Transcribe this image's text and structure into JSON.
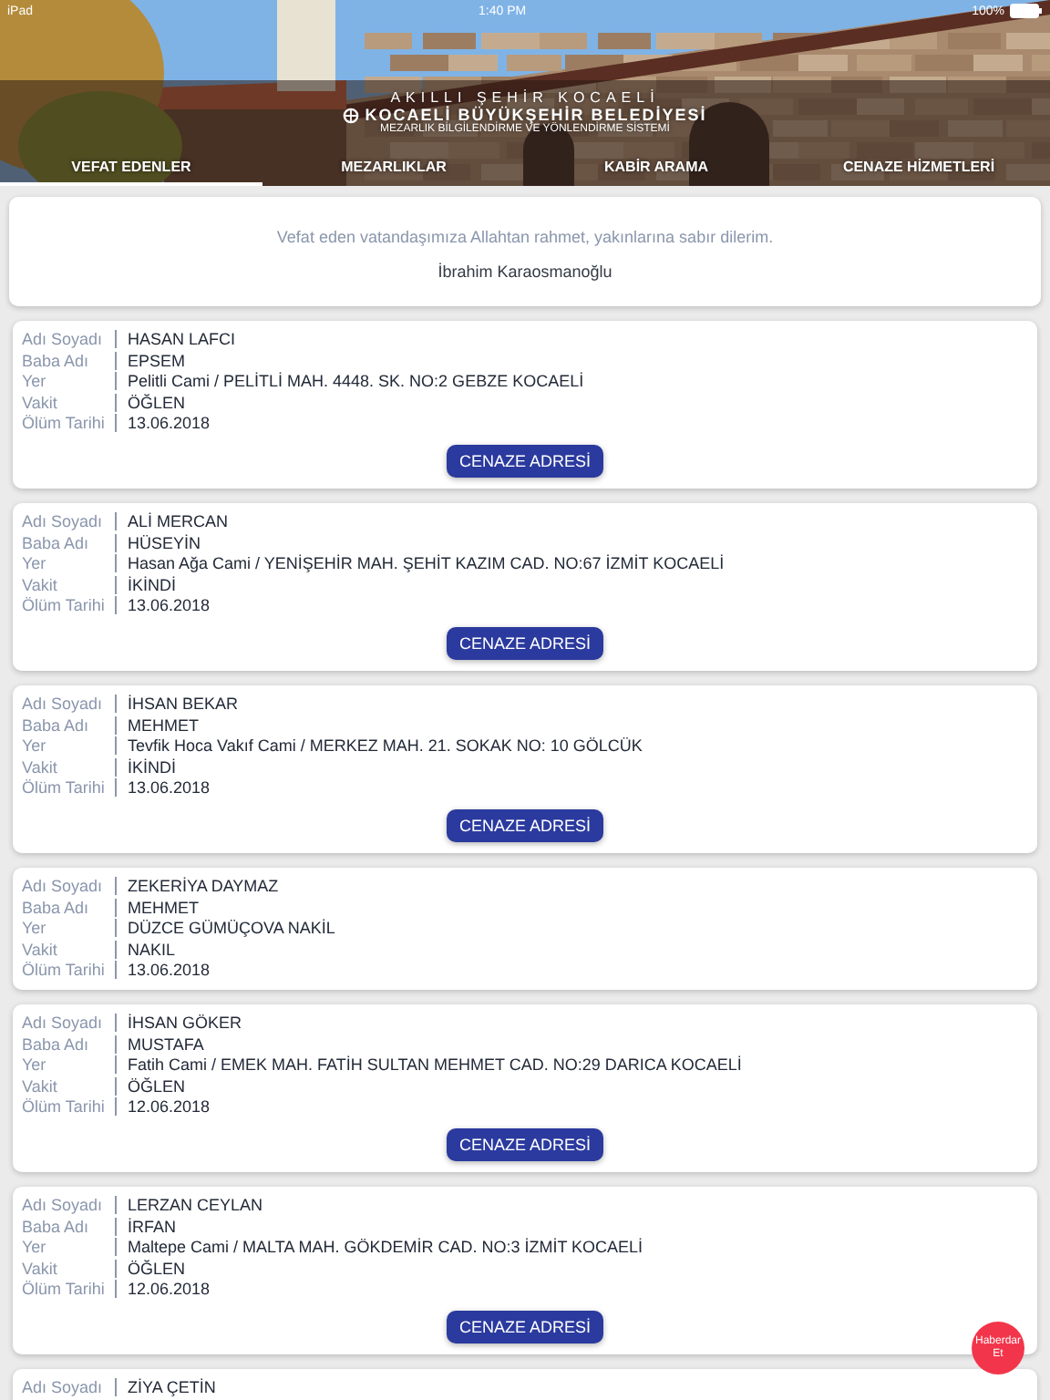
{
  "status_bar": {
    "carrier": "iPad",
    "time": "1:40 PM",
    "battery": "100%"
  },
  "header": {
    "tagline": "AKILLI ŞEHİR KOCAELİ",
    "title": "KOCAELİ BÜYÜKŞEHİR BELEDİYESİ",
    "subtitle": "MEZARLIK BİLGİLENDİRME VE YÖNLENDİRME SİSTEMİ"
  },
  "tabs": [
    {
      "label": "VEFAT EDENLER",
      "selected": true
    },
    {
      "label": "MEZARLIKLAR",
      "selected": false
    },
    {
      "label": "KABİR ARAMA",
      "selected": false
    },
    {
      "label": "CENAZE HİZMETLERİ",
      "selected": false
    }
  ],
  "intro": {
    "message": "Vefat eden vatandaşımıza Allahtan rahmet, yakınlarına sabır dilerim.",
    "signature": "İbrahim Karaosmanoğlu"
  },
  "records": [
    {
      "fields": [
        {
          "label": "Adı Soyadı",
          "value": "HASAN LAFCI"
        },
        {
          "label": "Baba Adı",
          "value": "EPSEM"
        },
        {
          "label": "Yer",
          "value": "Pelitli Cami / PELİTLİ MAH. 4448. SK. NO:2 GEBZE KOCAELİ"
        },
        {
          "label": "Vakit",
          "value": "ÖĞLEN"
        },
        {
          "label": "Ölüm Tarihi",
          "value": "13.06.2018"
        }
      ],
      "button": "CENAZE ADRESİ"
    },
    {
      "fields": [
        {
          "label": "Adı Soyadı",
          "value": "ALİ MERCAN"
        },
        {
          "label": "Baba Adı",
          "value": "HÜSEYİN"
        },
        {
          "label": "Yer",
          "value": "Hasan Ağa Cami / YENİŞEHİR MAH. ŞEHİT KAZIM CAD. NO:67 İZMİT KOCAELİ"
        },
        {
          "label": "Vakit",
          "value": "İKİNDİ"
        },
        {
          "label": "Ölüm Tarihi",
          "value": "13.06.2018"
        }
      ],
      "button": "CENAZE ADRESİ"
    },
    {
      "fields": [
        {
          "label": "Adı Soyadı",
          "value": "İHSAN BEKAR"
        },
        {
          "label": "Baba Adı",
          "value": "MEHMET"
        },
        {
          "label": "Yer",
          "value": "Tevfik Hoca Vakıf Cami / MERKEZ MAH. 21. SOKAK NO: 10 GÖLCÜK"
        },
        {
          "label": "Vakit",
          "value": "İKİNDİ"
        },
        {
          "label": "Ölüm Tarihi",
          "value": "13.06.2018"
        }
      ],
      "button": "CENAZE ADRESİ"
    },
    {
      "fields": [
        {
          "label": "Adı Soyadı",
          "value": "ZEKERİYA DAYMAZ"
        },
        {
          "label": "Baba Adı",
          "value": "MEHMET"
        },
        {
          "label": "Yer",
          "value": "DÜZCE GÜMÜÇOVA NAKİL"
        },
        {
          "label": "Vakit",
          "value": "NAKIL"
        },
        {
          "label": "Ölüm Tarihi",
          "value": "13.06.2018"
        }
      ]
    },
    {
      "fields": [
        {
          "label": "Adı Soyadı",
          "value": "İHSAN GÖKER"
        },
        {
          "label": "Baba Adı",
          "value": "MUSTAFA"
        },
        {
          "label": "Yer",
          "value": "Fatih Cami / EMEK MAH. FATİH SULTAN MEHMET CAD. NO:29 DARICA KOCAELİ"
        },
        {
          "label": "Vakit",
          "value": "ÖĞLEN"
        },
        {
          "label": "Ölüm Tarihi",
          "value": "12.06.2018"
        }
      ],
      "button": "CENAZE ADRESİ"
    },
    {
      "fields": [
        {
          "label": "Adı Soyadı",
          "value": "LERZAN CEYLAN"
        },
        {
          "label": "Baba Adı",
          "value": "İRFAN"
        },
        {
          "label": "Yer",
          "value": "Maltepe Cami / MALTA MAH. GÖKDEMİR CAD. NO:3 İZMİT KOCAELİ"
        },
        {
          "label": "Vakit",
          "value": "ÖĞLEN"
        },
        {
          "label": "Ölüm Tarihi",
          "value": "12.06.2018"
        }
      ],
      "button": "CENAZE ADRESİ"
    },
    {
      "fields": [
        {
          "label": "Adı Soyadı",
          "value": "ZİYA ÇETİN"
        }
      ]
    }
  ],
  "notify_button": "Haberdar Et"
}
